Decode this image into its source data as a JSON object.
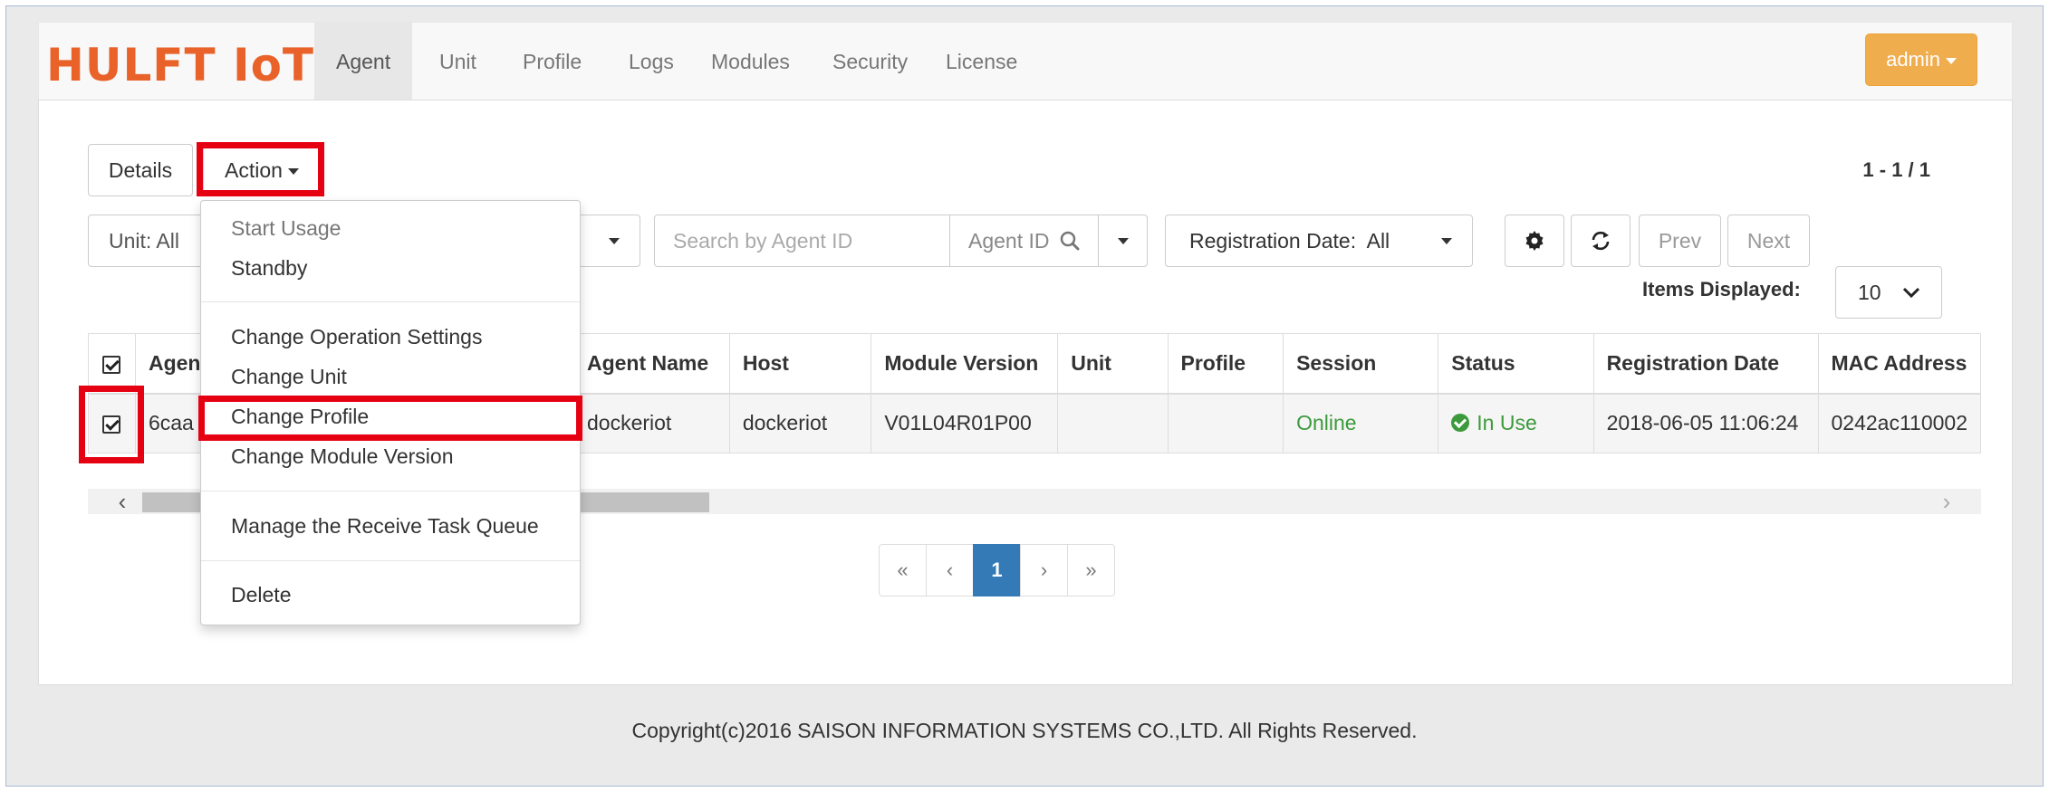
{
  "app": {
    "logo": "HULFT IoT"
  },
  "nav": {
    "items": [
      "Agent",
      "Unit",
      "Profile",
      "Logs",
      "Modules",
      "Security",
      "License"
    ],
    "active": "Agent",
    "user_label": "admin"
  },
  "toolbar": {
    "details_label": "Details",
    "action_label": "Action",
    "range_text": "1 - 1 / 1",
    "unit_filter": "Unit: All",
    "search_placeholder": "Search by Agent ID",
    "search_mode": "Agent ID",
    "registration_filter": "Registration Date:  All",
    "prev_label": "Prev",
    "next_label": "Next",
    "items_displayed_label": "Items Displayed:",
    "items_displayed_value": "10"
  },
  "action_menu": {
    "items": [
      "Start Usage",
      "Standby",
      "Change Operation Settings",
      "Change Unit",
      "Change Profile",
      "Change Module Version",
      "Manage the Receive Task Queue",
      "Delete"
    ]
  },
  "table": {
    "columns": [
      "Agen",
      "Agent Name",
      "Host",
      "Module Version",
      "Unit",
      "Profile",
      "Session",
      "Status",
      "Registration Date",
      "MAC Address"
    ],
    "rows": [
      {
        "agent_id": "6caa",
        "agent_name": "dockeriot",
        "host": "dockeriot",
        "module_version": "V01L04R01P00",
        "unit": "",
        "profile": "",
        "session": "Online",
        "status": "In Use",
        "registration_date": "2018-06-05 11:06:24",
        "mac_address": "0242ac110002"
      }
    ]
  },
  "pagination": {
    "first": "«",
    "prev": "‹",
    "current": "1",
    "next": "›",
    "last": "»"
  },
  "footer": {
    "copyright": "Copyright(c)2016 SAISON INFORMATION SYSTEMS CO.,LTD. All Rights Reserved."
  },
  "colors": {
    "brand": "#e8622a",
    "admin": "#f0ad4e",
    "highlight": "#e50012",
    "online": "#3c9a3c",
    "page_active": "#337ab7"
  }
}
